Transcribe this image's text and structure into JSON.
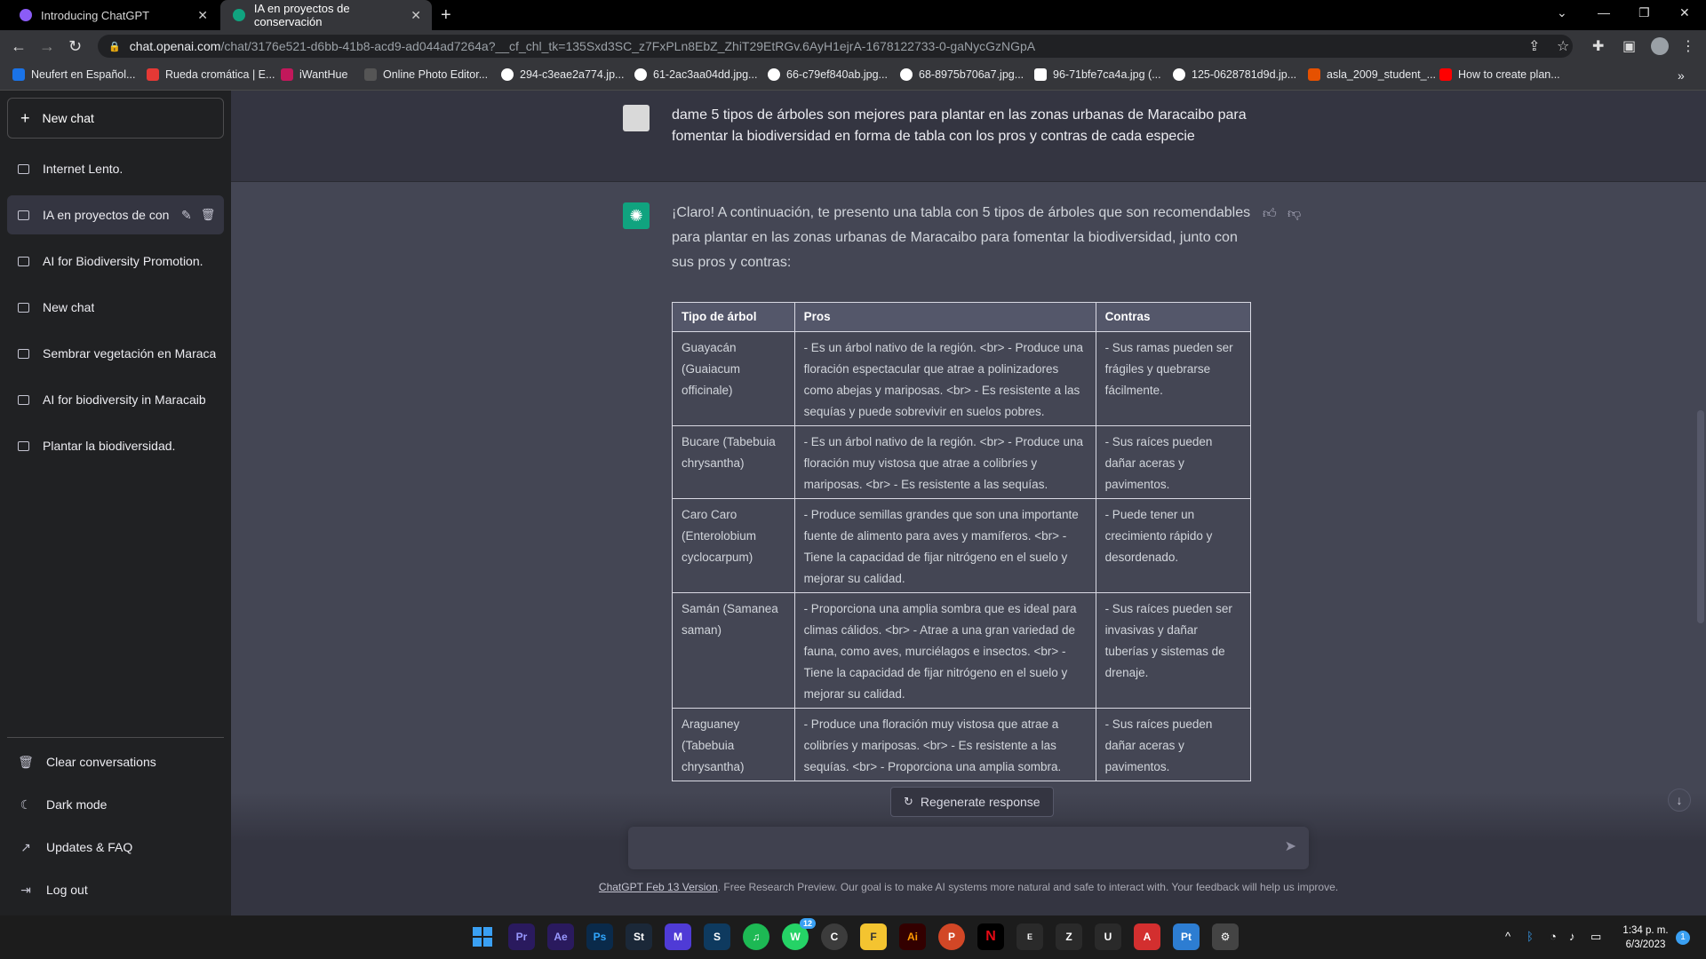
{
  "browser": {
    "tabs": [
      {
        "title": "Introducing ChatGPT"
      },
      {
        "title": "IA en proyectos de conservación"
      }
    ],
    "url_host": "chat.openai.com",
    "url_path": "/chat/3176e521-d6bb-41b8-acd9-ad044ad7264a?__cf_chl_tk=135Sxd3SC_z7FxPLn8EbZ_ZhiT29EtRGv.6AyH1ejrA-1678122733-0-gaNycGzNGpA",
    "bookmarks": [
      {
        "label": "Neufert en Español...",
        "color": "#1a73e8"
      },
      {
        "label": "Rueda cromática | E...",
        "color": "#e53935"
      },
      {
        "label": "iWantHue",
        "color": "#c2185b"
      },
      {
        "label": "Online Photo Editor...",
        "color": "#555555"
      },
      {
        "label": "294-c3eae2a774.jp...",
        "color": "#ffffff"
      },
      {
        "label": "61-2ac3aa04dd.jpg...",
        "color": "#ffffff"
      },
      {
        "label": "66-c79ef840ab.jpg...",
        "color": "#ffffff"
      },
      {
        "label": "68-8975b706a7.jpg...",
        "color": "#ffffff"
      },
      {
        "label": "96-71bfe7ca4a.jpg (...",
        "color": "#ffffff"
      },
      {
        "label": "125-0628781d9d.jp...",
        "color": "#ffffff"
      },
      {
        "label": "asla_2009_student_...",
        "color": "#e65100"
      },
      {
        "label": "How to create plan...",
        "color": "#ff0000"
      }
    ]
  },
  "sidebar": {
    "new_chat": "New chat",
    "conversations": [
      {
        "label": "Internet Lento."
      },
      {
        "label": "IA en proyectos de con"
      },
      {
        "label": "AI for Biodiversity Promotion."
      },
      {
        "label": "New chat"
      },
      {
        "label": "Sembrar vegetación en Maraca"
      },
      {
        "label": "AI for biodiversity in Maracaib"
      },
      {
        "label": "Plantar la biodiversidad."
      }
    ],
    "bottom": {
      "clear": "Clear conversations",
      "dark": "Dark mode",
      "updates": "Updates & FAQ",
      "logout": "Log out"
    }
  },
  "chat": {
    "user_message": "dame 5 tipos de árboles son mejores para plantar en las zonas urbanas de Maracaibo para fomentar la biodiversidad en forma de tabla con los pros y contras de cada especie",
    "assistant_intro": "¡Claro! A continuación, te presento una tabla con 5 tipos de árboles que son recomendables para plantar en las zonas urbanas de Maracaibo para fomentar la biodiversidad, junto con sus pros y contras:",
    "table": {
      "headers": [
        "Tipo de árbol",
        "Pros",
        "Contras"
      ],
      "rows": [
        [
          "Guayacán (Guaiacum officinale)",
          "- Es un árbol nativo de la región. <br> - Produce una floración espectacular que atrae a polinizadores como abejas y mariposas. <br> - Es resistente a las sequías y puede sobrevivir en suelos pobres.",
          "- Sus ramas pueden ser frágiles y quebrarse fácilmente."
        ],
        [
          "Bucare (Tabebuia chrysantha)",
          "- Es un árbol nativo de la región. <br> - Produce una floración muy vistosa que atrae a colibríes y mariposas. <br> - Es resistente a las sequías.",
          "- Sus raíces pueden dañar aceras y pavimentos."
        ],
        [
          "Caro Caro (Enterolobium cyclocarpum)",
          "- Produce semillas grandes que son una importante fuente de alimento para aves y mamíferos. <br> - Tiene la capacidad de fijar nitrógeno en el suelo y mejorar su calidad.",
          "- Puede tener un crecimiento rápido y desordenado."
        ],
        [
          "Samán (Samanea saman)",
          "- Proporciona una amplia sombra que es ideal para climas cálidos. <br> - Atrae a una gran variedad de fauna, como aves, murciélagos e insectos. <br> - Tiene la capacidad de fijar nitrógeno en el suelo y mejorar su calidad.",
          "- Sus raíces pueden ser invasivas y dañar tuberías y sistemas de drenaje."
        ],
        [
          "Araguaney (Tabebuia chrysantha)",
          "- Produce una floración muy vistosa que atrae a colibríes y mariposas. <br> - Es resistente a las sequías. <br> - Proporciona una amplia sombra.",
          "- Sus raíces pueden dañar aceras y pavimentos."
        ]
      ]
    },
    "regenerate": "Regenerate response",
    "footer_link": "ChatGPT Feb 13 Version",
    "footer_text": ". Free Research Preview. Our goal is to make AI systems more natural and safe to interact with. Your feedback will help us improve."
  },
  "taskbar": {
    "apps": [
      {
        "label": "Pr",
        "color": "#2a1a5e"
      },
      {
        "label": "Ae",
        "color": "#2a1a5e"
      },
      {
        "label": "Ps",
        "color": "#0a2a4a"
      },
      {
        "label": "St",
        "color": "#1b2838"
      },
      {
        "label": "M",
        "color": "#4f3bd6"
      },
      {
        "label": "S",
        "color": "#0e3a5f"
      },
      {
        "label": "♫",
        "color": "#1db954"
      },
      {
        "label": "W",
        "color": "#25d366"
      },
      {
        "label": "C",
        "color": "#3c3c3c"
      },
      {
        "label": "F",
        "color": "#f4c430"
      },
      {
        "label": "Ai",
        "color": "#330000"
      },
      {
        "label": "P",
        "color": "#d24726"
      },
      {
        "label": "N",
        "color": "#e50914"
      },
      {
        "label": "E",
        "color": "#2a2a2a"
      },
      {
        "label": "Z",
        "color": "#2a2a2a"
      },
      {
        "label": "U",
        "color": "#2a2a2a"
      },
      {
        "label": "A",
        "color": "#d32f2f"
      },
      {
        "label": "Pt",
        "color": "#2d7dd2"
      },
      {
        "label": "⚙",
        "color": "#444444"
      }
    ],
    "whatsapp_badge": "12",
    "time": "1:34 p. m.",
    "date": "6/3/2023",
    "notif": "1"
  }
}
